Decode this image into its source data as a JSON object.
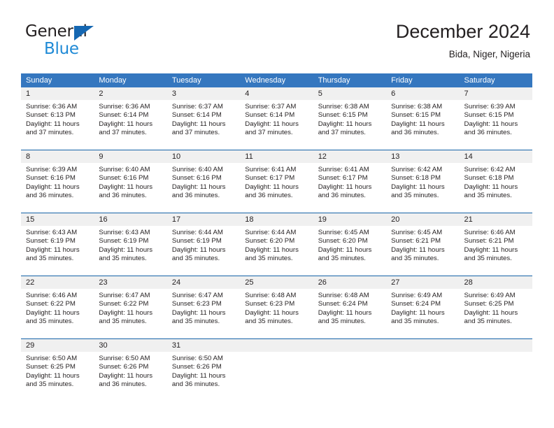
{
  "brand": {
    "name_part1": "General",
    "name_part2": "Blue",
    "triangle_icon": "triangle-logo-icon",
    "color_dark": "#231f20",
    "color_blue": "#1f8ad6",
    "color_triangle": "#1567b2"
  },
  "header": {
    "title": "December 2024",
    "subtitle": "Bida, Niger, Nigeria"
  },
  "theme": {
    "header_band": "#3577bf",
    "row_divider": "#1663a8",
    "daynum_strip": "#f0f0f0",
    "text": "#231f20"
  },
  "weekdays": [
    "Sunday",
    "Monday",
    "Tuesday",
    "Wednesday",
    "Thursday",
    "Friday",
    "Saturday"
  ],
  "weeks": [
    [
      {
        "day": "1",
        "sunrise": "Sunrise: 6:36 AM",
        "sunset": "Sunset: 6:13 PM",
        "daylight1": "Daylight: 11 hours",
        "daylight2": "and 37 minutes."
      },
      {
        "day": "2",
        "sunrise": "Sunrise: 6:36 AM",
        "sunset": "Sunset: 6:14 PM",
        "daylight1": "Daylight: 11 hours",
        "daylight2": "and 37 minutes."
      },
      {
        "day": "3",
        "sunrise": "Sunrise: 6:37 AM",
        "sunset": "Sunset: 6:14 PM",
        "daylight1": "Daylight: 11 hours",
        "daylight2": "and 37 minutes."
      },
      {
        "day": "4",
        "sunrise": "Sunrise: 6:37 AM",
        "sunset": "Sunset: 6:14 PM",
        "daylight1": "Daylight: 11 hours",
        "daylight2": "and 37 minutes."
      },
      {
        "day": "5",
        "sunrise": "Sunrise: 6:38 AM",
        "sunset": "Sunset: 6:15 PM",
        "daylight1": "Daylight: 11 hours",
        "daylight2": "and 37 minutes."
      },
      {
        "day": "6",
        "sunrise": "Sunrise: 6:38 AM",
        "sunset": "Sunset: 6:15 PM",
        "daylight1": "Daylight: 11 hours",
        "daylight2": "and 36 minutes."
      },
      {
        "day": "7",
        "sunrise": "Sunrise: 6:39 AM",
        "sunset": "Sunset: 6:15 PM",
        "daylight1": "Daylight: 11 hours",
        "daylight2": "and 36 minutes."
      }
    ],
    [
      {
        "day": "8",
        "sunrise": "Sunrise: 6:39 AM",
        "sunset": "Sunset: 6:16 PM",
        "daylight1": "Daylight: 11 hours",
        "daylight2": "and 36 minutes."
      },
      {
        "day": "9",
        "sunrise": "Sunrise: 6:40 AM",
        "sunset": "Sunset: 6:16 PM",
        "daylight1": "Daylight: 11 hours",
        "daylight2": "and 36 minutes."
      },
      {
        "day": "10",
        "sunrise": "Sunrise: 6:40 AM",
        "sunset": "Sunset: 6:16 PM",
        "daylight1": "Daylight: 11 hours",
        "daylight2": "and 36 minutes."
      },
      {
        "day": "11",
        "sunrise": "Sunrise: 6:41 AM",
        "sunset": "Sunset: 6:17 PM",
        "daylight1": "Daylight: 11 hours",
        "daylight2": "and 36 minutes."
      },
      {
        "day": "12",
        "sunrise": "Sunrise: 6:41 AM",
        "sunset": "Sunset: 6:17 PM",
        "daylight1": "Daylight: 11 hours",
        "daylight2": "and 36 minutes."
      },
      {
        "day": "13",
        "sunrise": "Sunrise: 6:42 AM",
        "sunset": "Sunset: 6:18 PM",
        "daylight1": "Daylight: 11 hours",
        "daylight2": "and 35 minutes."
      },
      {
        "day": "14",
        "sunrise": "Sunrise: 6:42 AM",
        "sunset": "Sunset: 6:18 PM",
        "daylight1": "Daylight: 11 hours",
        "daylight2": "and 35 minutes."
      }
    ],
    [
      {
        "day": "15",
        "sunrise": "Sunrise: 6:43 AM",
        "sunset": "Sunset: 6:19 PM",
        "daylight1": "Daylight: 11 hours",
        "daylight2": "and 35 minutes."
      },
      {
        "day": "16",
        "sunrise": "Sunrise: 6:43 AM",
        "sunset": "Sunset: 6:19 PM",
        "daylight1": "Daylight: 11 hours",
        "daylight2": "and 35 minutes."
      },
      {
        "day": "17",
        "sunrise": "Sunrise: 6:44 AM",
        "sunset": "Sunset: 6:19 PM",
        "daylight1": "Daylight: 11 hours",
        "daylight2": "and 35 minutes."
      },
      {
        "day": "18",
        "sunrise": "Sunrise: 6:44 AM",
        "sunset": "Sunset: 6:20 PM",
        "daylight1": "Daylight: 11 hours",
        "daylight2": "and 35 minutes."
      },
      {
        "day": "19",
        "sunrise": "Sunrise: 6:45 AM",
        "sunset": "Sunset: 6:20 PM",
        "daylight1": "Daylight: 11 hours",
        "daylight2": "and 35 minutes."
      },
      {
        "day": "20",
        "sunrise": "Sunrise: 6:45 AM",
        "sunset": "Sunset: 6:21 PM",
        "daylight1": "Daylight: 11 hours",
        "daylight2": "and 35 minutes."
      },
      {
        "day": "21",
        "sunrise": "Sunrise: 6:46 AM",
        "sunset": "Sunset: 6:21 PM",
        "daylight1": "Daylight: 11 hours",
        "daylight2": "and 35 minutes."
      }
    ],
    [
      {
        "day": "22",
        "sunrise": "Sunrise: 6:46 AM",
        "sunset": "Sunset: 6:22 PM",
        "daylight1": "Daylight: 11 hours",
        "daylight2": "and 35 minutes."
      },
      {
        "day": "23",
        "sunrise": "Sunrise: 6:47 AM",
        "sunset": "Sunset: 6:22 PM",
        "daylight1": "Daylight: 11 hours",
        "daylight2": "and 35 minutes."
      },
      {
        "day": "24",
        "sunrise": "Sunrise: 6:47 AM",
        "sunset": "Sunset: 6:23 PM",
        "daylight1": "Daylight: 11 hours",
        "daylight2": "and 35 minutes."
      },
      {
        "day": "25",
        "sunrise": "Sunrise: 6:48 AM",
        "sunset": "Sunset: 6:23 PM",
        "daylight1": "Daylight: 11 hours",
        "daylight2": "and 35 minutes."
      },
      {
        "day": "26",
        "sunrise": "Sunrise: 6:48 AM",
        "sunset": "Sunset: 6:24 PM",
        "daylight1": "Daylight: 11 hours",
        "daylight2": "and 35 minutes."
      },
      {
        "day": "27",
        "sunrise": "Sunrise: 6:49 AM",
        "sunset": "Sunset: 6:24 PM",
        "daylight1": "Daylight: 11 hours",
        "daylight2": "and 35 minutes."
      },
      {
        "day": "28",
        "sunrise": "Sunrise: 6:49 AM",
        "sunset": "Sunset: 6:25 PM",
        "daylight1": "Daylight: 11 hours",
        "daylight2": "and 35 minutes."
      }
    ],
    [
      {
        "day": "29",
        "sunrise": "Sunrise: 6:50 AM",
        "sunset": "Sunset: 6:25 PM",
        "daylight1": "Daylight: 11 hours",
        "daylight2": "and 35 minutes."
      },
      {
        "day": "30",
        "sunrise": "Sunrise: 6:50 AM",
        "sunset": "Sunset: 6:26 PM",
        "daylight1": "Daylight: 11 hours",
        "daylight2": "and 36 minutes."
      },
      {
        "day": "31",
        "sunrise": "Sunrise: 6:50 AM",
        "sunset": "Sunset: 6:26 PM",
        "daylight1": "Daylight: 11 hours",
        "daylight2": "and 36 minutes."
      },
      {
        "day": "",
        "sunrise": "",
        "sunset": "",
        "daylight1": "",
        "daylight2": ""
      },
      {
        "day": "",
        "sunrise": "",
        "sunset": "",
        "daylight1": "",
        "daylight2": ""
      },
      {
        "day": "",
        "sunrise": "",
        "sunset": "",
        "daylight1": "",
        "daylight2": ""
      },
      {
        "day": "",
        "sunrise": "",
        "sunset": "",
        "daylight1": "",
        "daylight2": ""
      }
    ]
  ]
}
